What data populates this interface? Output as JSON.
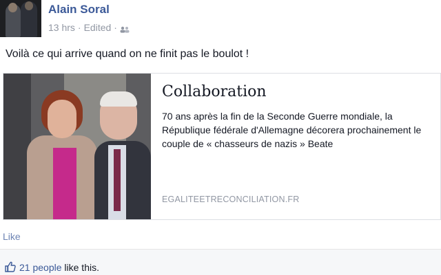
{
  "post": {
    "author": "Alain Soral",
    "time": "13 hrs",
    "edited": "Edited",
    "separator": "·",
    "text": "Voilà ce qui arrive quand on ne finit pas le boulot !"
  },
  "link_card": {
    "title": "Collaboration",
    "description": "70 ans après la fin de la Seconde Guerre mondiale, la République fédérale d'Allemagne décorera prochainement le couple de « chasseurs de nazis » Beate",
    "domain": "EGALITEETRECONCILIATION.FR"
  },
  "actions": {
    "like_label": "Like"
  },
  "likes": {
    "count_label": "21 people",
    "suffix": "like this."
  },
  "colors": {
    "link_blue": "#3b5998",
    "meta_gray": "#9197a3",
    "like_action": "#6d84b4",
    "woman_top": "#c52a8b"
  },
  "icons": {
    "audience": "friends-icon",
    "like": "thumbs-up-icon"
  }
}
